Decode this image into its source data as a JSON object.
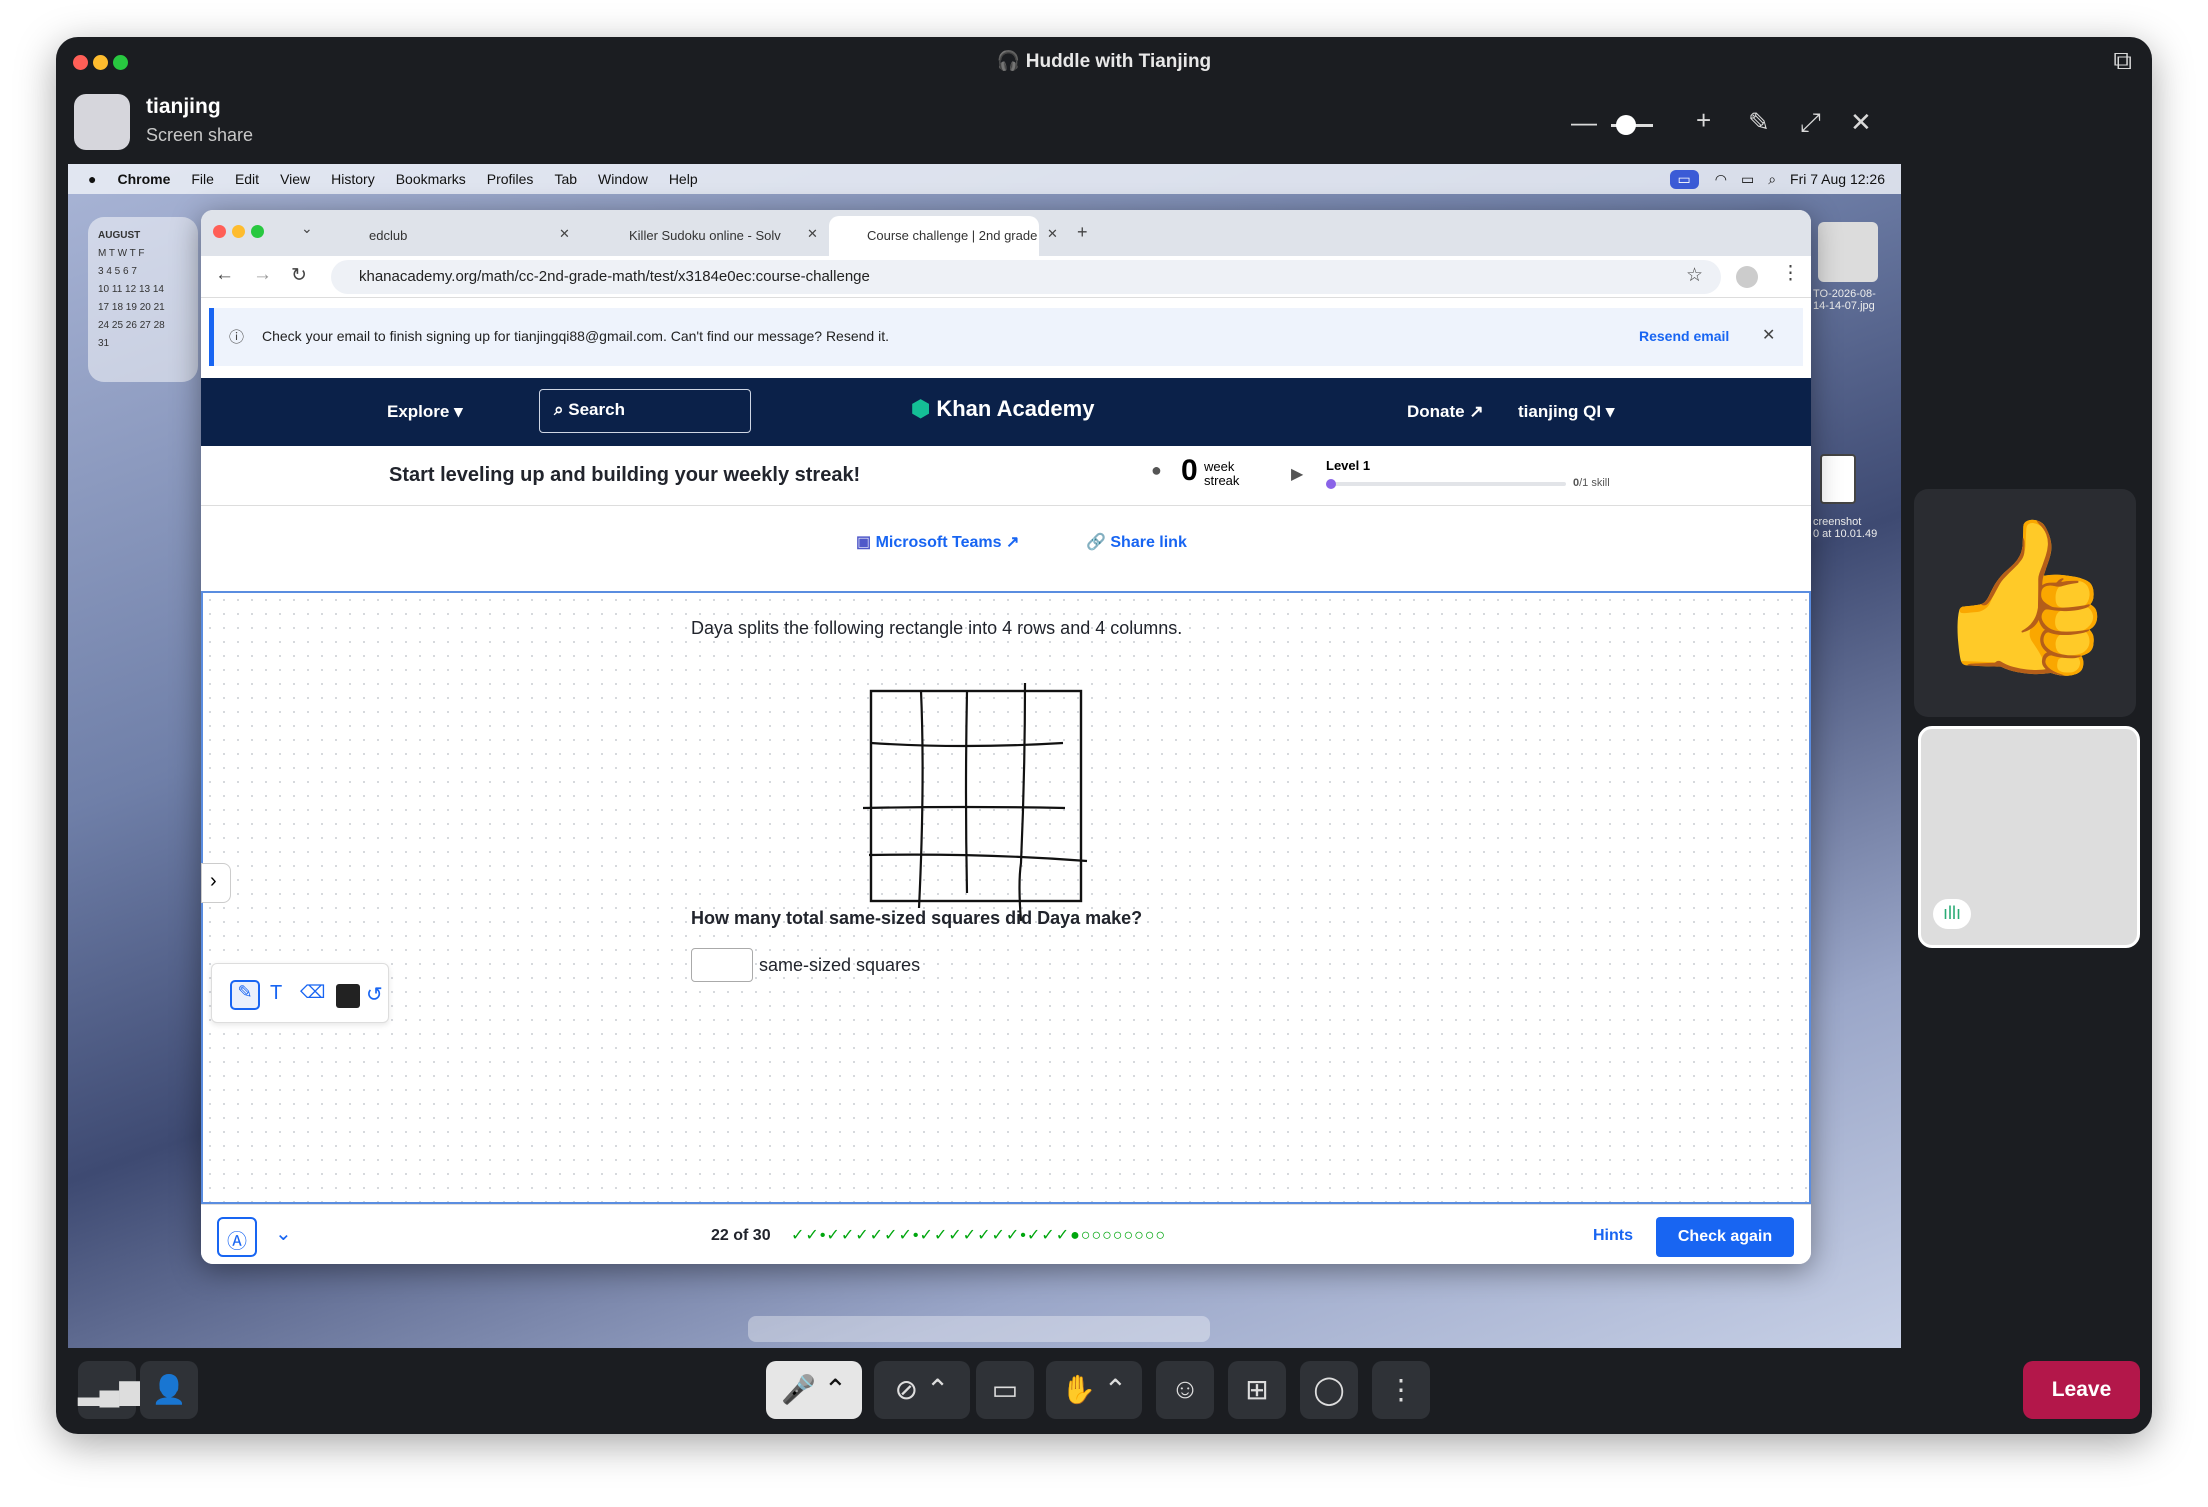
{
  "window": {
    "title": "Huddle with Tianjing"
  },
  "presenter": {
    "name": "tianjing",
    "subtitle": "Screen share"
  },
  "mac_menu": {
    "items": [
      "Chrome",
      "File",
      "Edit",
      "View",
      "History",
      "Bookmarks",
      "Profiles",
      "Tab",
      "Window",
      "Help"
    ],
    "clock": "Fri 7 Aug  12:26"
  },
  "calendar": {
    "month": "AUGUST",
    "header": "M  T  W  T  F",
    "rows": [
      "3  4  5  6  7",
      "10 11 12 13 14",
      "17 18 19 20 21",
      "24 25 26 27 28",
      "31"
    ]
  },
  "tabs": [
    {
      "label": "edclub"
    },
    {
      "label": "Killer Sudoku online - Solve d"
    },
    {
      "label": "Course challenge | 2nd grade"
    }
  ],
  "address": {
    "url": "khanacademy.org/math/cc-2nd-grade-math/test/x3184e0ec:course-challenge"
  },
  "notice": {
    "text": "Check your email to finish signing up for tianjingqi88@gmail.com. Can't find our message? Resend it.",
    "resend": "Resend email"
  },
  "nav": {
    "explore": "Explore",
    "search": "Search",
    "brand": "Khan Academy",
    "donate": "Donate",
    "user": "tianjing QI"
  },
  "streak": {
    "message": "Start leveling up and building your weekly streak!",
    "count": "0",
    "label1": "week",
    "label2": "streak",
    "level": "Level 1",
    "progress": "0",
    "progress_total": "/1 skill"
  },
  "share": {
    "teams": "Microsoft Teams",
    "link": "Share link"
  },
  "exercise": {
    "prompt": "Daya splits the following rectangle into 4 rows and 4 columns.",
    "question": "How many total same-sized squares did Daya make?",
    "unit": "same-sized squares"
  },
  "footer": {
    "progress": "22 of 30",
    "hints": "Hints",
    "check": "Check again",
    "marks": "✓✓•✓✓✓✓✓✓•✓✓✓✓✓✓✓•✓✓✓●○○○○○○○○"
  },
  "desktop": {
    "file1": "TO-2026-08-\n14-14-07.jpg",
    "file2": "creenshot\n0 at 10.01.49"
  },
  "controls": {
    "leave": "Leave"
  }
}
